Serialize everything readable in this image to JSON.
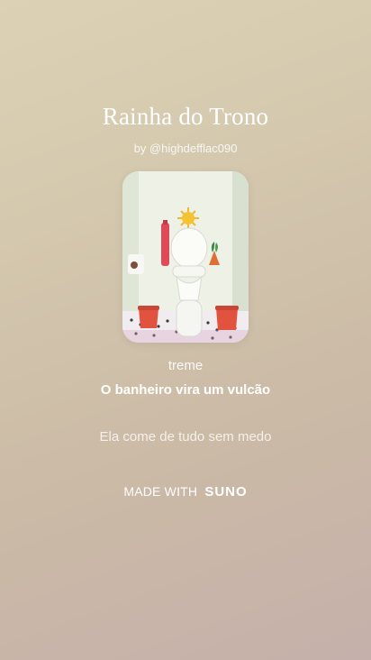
{
  "song": {
    "title": "Rainha do Trono",
    "byline": "by @highdefflac090"
  },
  "lyrics": {
    "previous": "treme",
    "current": "O banheiro vira um vulcão",
    "next": "Ela come de tudo sem medo"
  },
  "footer": {
    "made_with": "MADE WITH",
    "brand": "SUNO"
  },
  "colors": {
    "background_top": "#ddd1b5",
    "background_bottom": "#c6b0ab",
    "text": "#ffffff"
  }
}
